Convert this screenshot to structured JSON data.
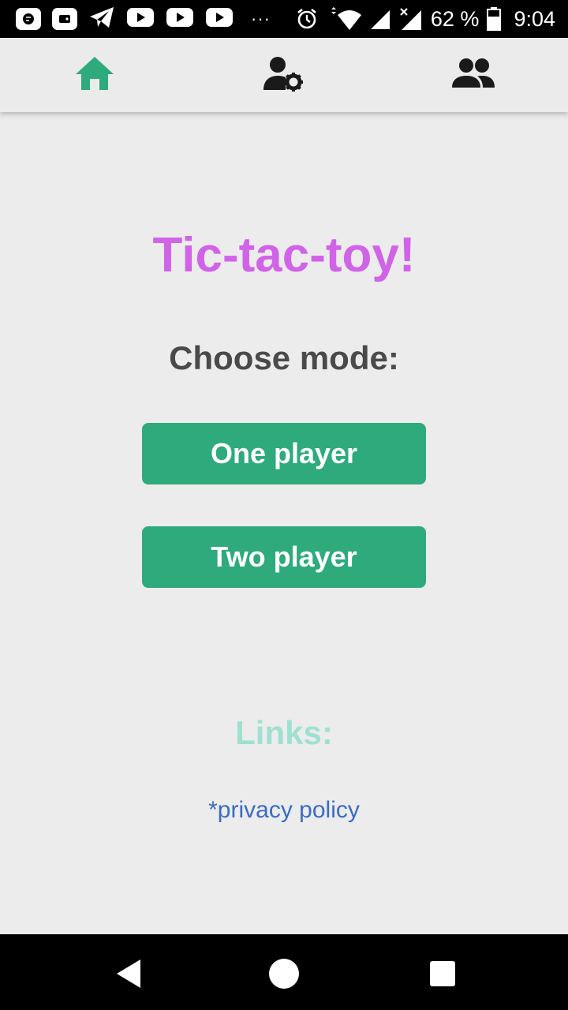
{
  "status_bar": {
    "battery_percent": "62 %",
    "time": "9:04",
    "more_notifications": "···",
    "icons": [
      "chat-app-icon",
      "wallet-app-icon",
      "telegram-icon",
      "youtube-icon",
      "youtube-icon",
      "youtube-icon",
      "alarm-icon",
      "wifi-icon",
      "signal-icon",
      "signal-no-service-icon",
      "battery-icon"
    ]
  },
  "top_nav": {
    "items": [
      {
        "icon": "home-icon",
        "active": true
      },
      {
        "icon": "user-settings-icon",
        "active": false
      },
      {
        "icon": "group-icon",
        "active": false
      }
    ],
    "active_color": "#2eaa7d",
    "inactive_color": "#1a1a1a"
  },
  "main": {
    "title": "Tic-tac-toy!",
    "subtitle": "Choose mode:",
    "buttons": {
      "one_player": "One player",
      "two_player": "Two player"
    }
  },
  "links": {
    "heading": "Links:",
    "privacy_policy": "*privacy policy"
  },
  "colors": {
    "title": "#d163e8",
    "button": "#2eaa7d",
    "links_heading": "#9fe0d0",
    "link": "#3a6cc4",
    "background": "#ececec"
  },
  "android_nav": {
    "icons": [
      "back-icon",
      "home-circle-icon",
      "recents-icon"
    ]
  }
}
